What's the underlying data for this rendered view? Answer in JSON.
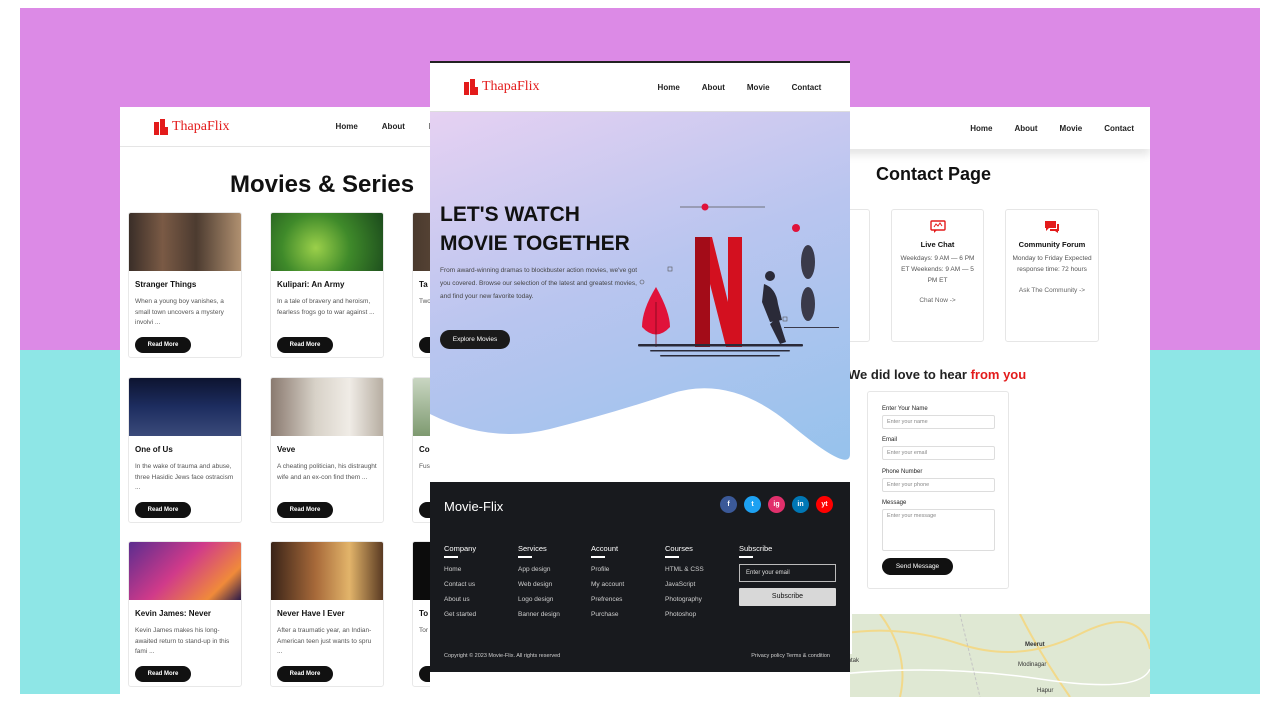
{
  "brand": {
    "logo_text": "ThapaFlix"
  },
  "nav": {
    "home": "Home",
    "about": "About",
    "movie": "Movie",
    "contact": "Contact",
    "movie_trunc": "Mo"
  },
  "movies_page": {
    "title": "Movies & Series",
    "read_more": "Read More",
    "cards": [
      {
        "title": "Stranger Things",
        "desc": "When a young boy vanishes, a small town uncovers a mystery involvi ..."
      },
      {
        "title": "Kulipari: An Army",
        "desc": "In a tale of bravery and heroism, fearless frogs go to war against ..."
      },
      {
        "title": "Ta",
        "desc": "Two ... enc ... min ..."
      },
      {
        "title": "One of Us",
        "desc": "In the wake of trauma and abuse, three Hasidic Jews face ostracism ..."
      },
      {
        "title": "Veve",
        "desc": "A cheating politician, his distraught wife and an ex-con find them ..."
      },
      {
        "title": "Co",
        "desc": "Fus ... upl ... cre ..."
      },
      {
        "title": "Kevin James: Never",
        "desc": "Kevin James makes his long-awaited return to stand-up in this fami ..."
      },
      {
        "title": "Never Have I Ever",
        "desc": "After a traumatic year, an Indian-American teen just wants to spru ..."
      },
      {
        "title": "To",
        "desc": "Tor ... an ... rea ..."
      }
    ]
  },
  "home_page": {
    "hero_title_1": "LET'S WATCH",
    "hero_title_2": "MOVIE TOGETHER",
    "hero_text": "From award-winning dramas to blockbuster action movies, we've got you covered. Browse our selection of the latest and greatest movies, and find your new favorite today.",
    "hero_button": "Explore Movies",
    "footer": {
      "brand": "Movie-Flix",
      "social": [
        "f",
        "t",
        "ig",
        "in",
        "yt"
      ],
      "columns": [
        {
          "heading": "Company",
          "items": [
            "Home",
            "Contact us",
            "About us",
            "Get started"
          ]
        },
        {
          "heading": "Services",
          "items": [
            "App design",
            "Web design",
            "Logo design",
            "Banner design"
          ]
        },
        {
          "heading": "Account",
          "items": [
            "Profile",
            "My account",
            "Prefrences",
            "Purchase"
          ]
        },
        {
          "heading": "Courses",
          "items": [
            "HTML & CSS",
            "JavaScript",
            "Photography",
            "Photoshop"
          ]
        },
        {
          "heading": "Subscribe",
          "items": []
        }
      ],
      "email_placeholder": "Enter your email",
      "subscribe_button": "Subscribe",
      "copyright": "Copyright © 2023 Movie-Flix.    All rights reserved",
      "legal": "Privacy policy   Terms & condition"
    }
  },
  "contact_page": {
    "title": "Contact Page",
    "live_chat": {
      "title": "Live Chat",
      "body": "Weekdays: 9 AM — 6 PM ET Weekends: 9 AM — 5 PM ET",
      "link": "Chat Now ->"
    },
    "community": {
      "title": "Community Forum",
      "body": "Monday to Friday Expected response time: 72 hours",
      "link": "Ask The Community ->"
    },
    "hear_prefix": "We did love to hear ",
    "hear_red": "from you",
    "form": {
      "name_label": "Enter Your Name",
      "name_ph": "Enter your name",
      "email_label": "Email",
      "email_ph": "Enter your email",
      "phone_label": "Phone Number",
      "phone_ph": "Enter your phone",
      "message_label": "Message",
      "message_ph": "Enter your message",
      "send": "Send Message"
    },
    "map_labels": [
      "Rohtak",
      "Meerut",
      "Modinagar",
      "Hapur"
    ]
  },
  "colors": {
    "accent": "#e31b1b",
    "dark": "#181a1e",
    "purple_bg": "#dc8ae6",
    "cyan_bg": "#8ee6e6"
  }
}
